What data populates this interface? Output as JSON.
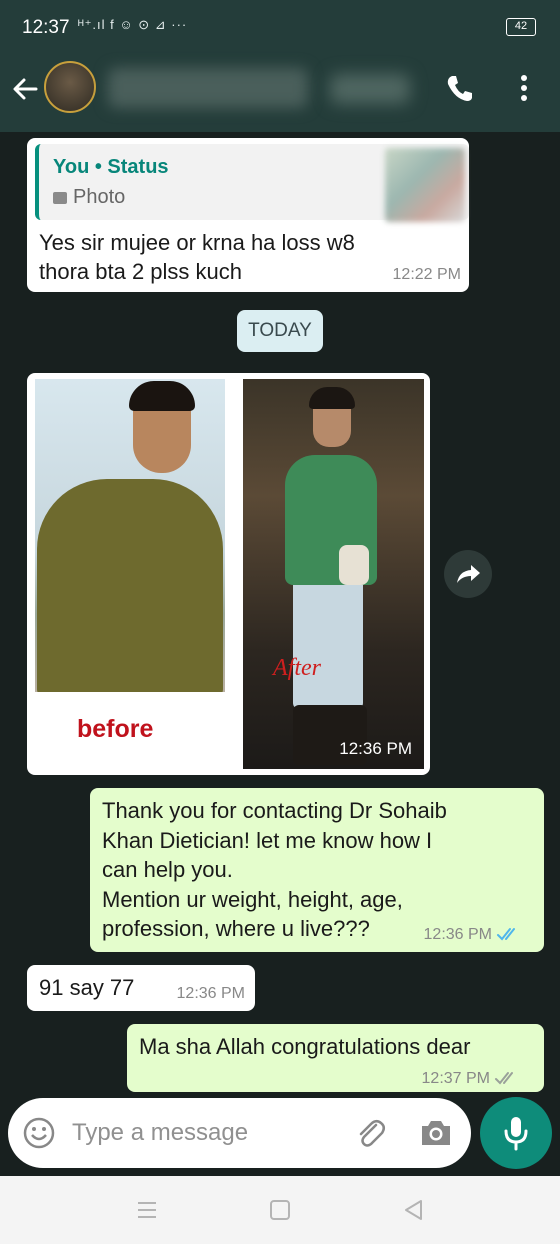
{
  "status_bar": {
    "time": "12:37",
    "indicators": "ᴴ⁺.ıl  f ☺ ⊙ ⊿ ···",
    "battery": "42"
  },
  "header": {
    "back_icon": "arrow-left-icon",
    "call_icon": "phone-icon",
    "menu_icon": "more-vertical-icon"
  },
  "messages": {
    "m1": {
      "reply_title": "You • Status",
      "reply_subtitle": "Photo",
      "text_line1": "Yes  sir mujee or krna ha loss w8",
      "text_line2": "thora bta 2 plss kuch",
      "time": "12:22 PM"
    },
    "date_separator": "TODAY",
    "m2": {
      "before_label": "before",
      "after_label": "After",
      "time": "12:36 PM"
    },
    "m3": {
      "lines": [
        "Thank you for contacting Dr Sohaib",
        "Khan Dietician! let me know how I",
        "can help you.",
        "Mention ur weight, height, age,",
        "profession, where u live???"
      ],
      "time": "12:36 PM"
    },
    "m4": {
      "text": "91 say 77",
      "time": "12:36 PM"
    },
    "m5": {
      "text": "Ma sha Allah congratulations dear",
      "time": "12:37 PM"
    }
  },
  "composer": {
    "placeholder": "Type a message"
  },
  "colors": {
    "header": "#243d3a",
    "outgoing": "#e4fdcc",
    "incoming": "#ffffff",
    "accent": "#0e8c7a",
    "read_tick": "#4fb6ec"
  }
}
